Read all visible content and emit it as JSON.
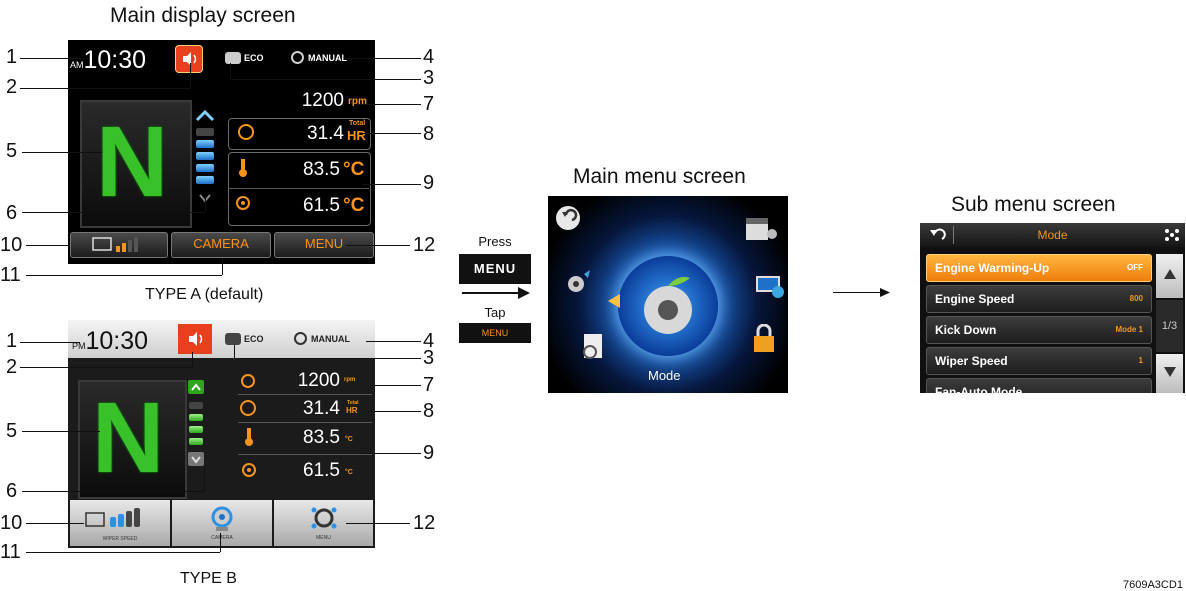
{
  "titles": {
    "main_display": "Main display screen",
    "main_menu": "Main menu screen",
    "sub_menu": "Sub menu screen"
  },
  "captions": {
    "type_a": "TYPE A (default)",
    "type_b": "TYPE B"
  },
  "callouts": [
    "1",
    "2",
    "3",
    "4",
    "5",
    "6",
    "7",
    "8",
    "9",
    "10",
    "11",
    "12"
  ],
  "type_a": {
    "ampm": "AM",
    "time": "10:30",
    "eco": "ECO",
    "manual": "MANUAL",
    "gear": "N",
    "rpm": "1200",
    "rpm_unit": "rpm",
    "hours": "31.4",
    "hours_unit_top": "Total",
    "hours_unit": "HR",
    "temp1": "83.5",
    "temp2": "61.5",
    "temp_unit": "°C",
    "camera": "CAMERA",
    "menu": "MENU"
  },
  "type_b": {
    "ampm": "PM",
    "time": "10:30",
    "eco": "ECO",
    "manual": "MANUAL",
    "gear": "N",
    "rpm": "1200",
    "rpm_unit": "rpm",
    "hours": "31.4",
    "hours_unit_top": "Total",
    "hours_unit": "HR",
    "temp1": "83.5",
    "temp2": "61.5",
    "temp_unit": "°C",
    "wiper_label": "WIPER SPEED",
    "camera_label": "CAMERA",
    "menu_label": "MENU"
  },
  "transition": {
    "press": "Press",
    "menu_key": "MENU",
    "tap": "Tap",
    "menu_touch": "MENU"
  },
  "main_menu": {
    "label": "Mode"
  },
  "sub_menu": {
    "title": "Mode",
    "page": "1/3",
    "items": [
      {
        "label": "Engine Warming-Up",
        "value": "OFF"
      },
      {
        "label": "Engine Speed",
        "value": "800"
      },
      {
        "label": "Kick Down",
        "value": "Mode 1"
      },
      {
        "label": "Wiper Speed",
        "value": "1"
      },
      {
        "label": "Fan-Auto Mode",
        "value": ""
      }
    ]
  },
  "figure_ref": "7609A3CD1",
  "colors": {
    "accent_orange": "#f7941d",
    "gear_green": "#39c12a",
    "level_blue": "#2f8fe0",
    "speaker_red": "#e8401c"
  }
}
